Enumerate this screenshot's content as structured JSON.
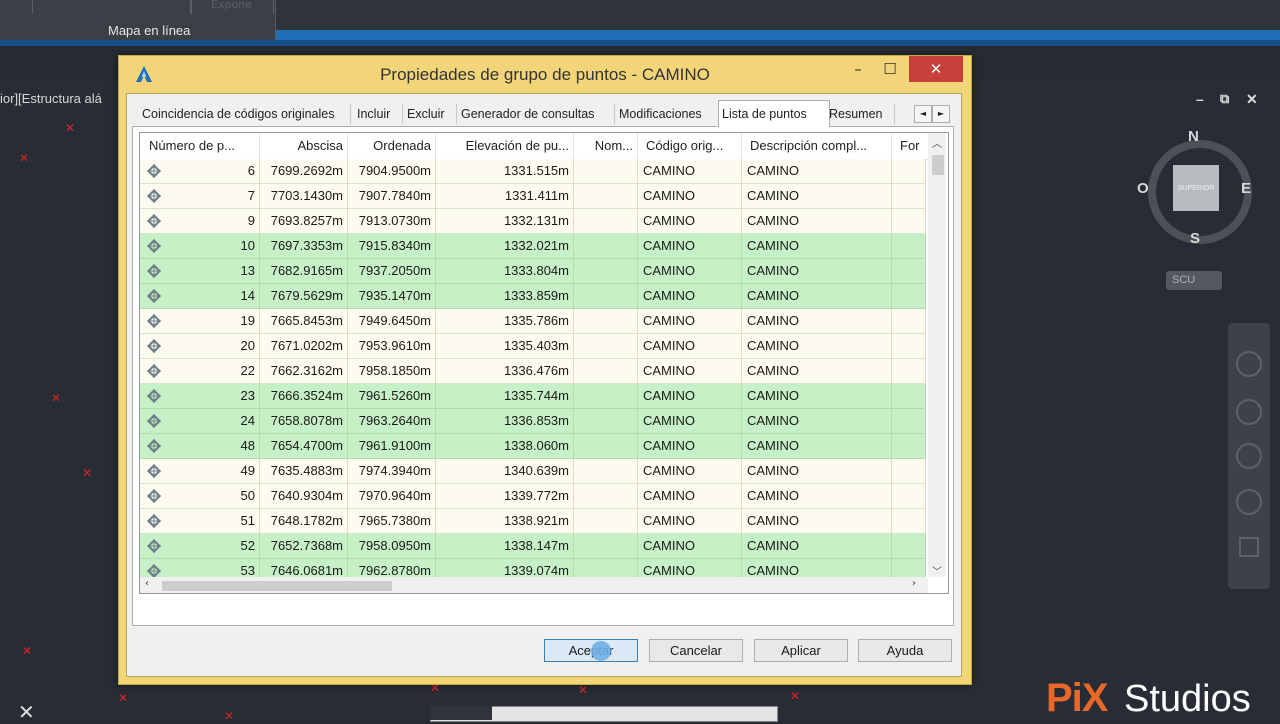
{
  "ribbon": {
    "label": "Mapa en línea",
    "faint_label": "Expone"
  },
  "drawing": {
    "header": "ior][Estructura alá"
  },
  "window_controls": {
    "minimize": "–",
    "restore": "⧉",
    "close": "✕"
  },
  "viewcube": {
    "face": "SUPERIOR",
    "north": "N",
    "south": "S",
    "east": "E",
    "west": "O",
    "ucs": "SCU"
  },
  "dialog": {
    "title": "Propiedades de grupo de puntos - CAMINO",
    "minimize": "–",
    "maximize": "☐",
    "close": "✕",
    "tabs": [
      "Coincidencia de códigos originales",
      "Incluir",
      "Excluir",
      "Generador de consultas",
      "Modificaciones",
      "Lista de puntos",
      "Resumen"
    ],
    "active_tab": "Lista de puntos",
    "tab_prev": "◄",
    "tab_next": "►",
    "columns": [
      "Número de p...",
      "Abscisa",
      "Ordenada",
      "Elevación de pu...",
      "Nom...",
      "Código orig...",
      "Descripción compl...",
      "For"
    ],
    "rows": [
      {
        "num": "6",
        "abscisa": "7699.2692m",
        "ordenada": "7904.9500m",
        "elevacion": "1331.515m",
        "nombre": "",
        "codigo": "CAMINO",
        "descripcion": "CAMINO",
        "highlight": false
      },
      {
        "num": "7",
        "abscisa": "7703.1430m",
        "ordenada": "7907.7840m",
        "elevacion": "1331.411m",
        "nombre": "",
        "codigo": "CAMINO",
        "descripcion": "CAMINO",
        "highlight": false
      },
      {
        "num": "9",
        "abscisa": "7693.8257m",
        "ordenada": "7913.0730m",
        "elevacion": "1332.131m",
        "nombre": "",
        "codigo": "CAMINO",
        "descripcion": "CAMINO",
        "highlight": false
      },
      {
        "num": "10",
        "abscisa": "7697.3353m",
        "ordenada": "7915.8340m",
        "elevacion": "1332.021m",
        "nombre": "",
        "codigo": "CAMINO",
        "descripcion": "CAMINO",
        "highlight": true
      },
      {
        "num": "13",
        "abscisa": "7682.9165m",
        "ordenada": "7937.2050m",
        "elevacion": "1333.804m",
        "nombre": "",
        "codigo": "CAMINO",
        "descripcion": "CAMINO",
        "highlight": true
      },
      {
        "num": "14",
        "abscisa": "7679.5629m",
        "ordenada": "7935.1470m",
        "elevacion": "1333.859m",
        "nombre": "",
        "codigo": "CAMINO",
        "descripcion": "CAMINO",
        "highlight": true
      },
      {
        "num": "19",
        "abscisa": "7665.8453m",
        "ordenada": "7949.6450m",
        "elevacion": "1335.786m",
        "nombre": "",
        "codigo": "CAMINO",
        "descripcion": "CAMINO",
        "highlight": false
      },
      {
        "num": "20",
        "abscisa": "7671.0202m",
        "ordenada": "7953.9610m",
        "elevacion": "1335.403m",
        "nombre": "",
        "codigo": "CAMINO",
        "descripcion": "CAMINO",
        "highlight": false
      },
      {
        "num": "22",
        "abscisa": "7662.3162m",
        "ordenada": "7958.1850m",
        "elevacion": "1336.476m",
        "nombre": "",
        "codigo": "CAMINO",
        "descripcion": "CAMINO",
        "highlight": false
      },
      {
        "num": "23",
        "abscisa": "7666.3524m",
        "ordenada": "7961.5260m",
        "elevacion": "1335.744m",
        "nombre": "",
        "codigo": "CAMINO",
        "descripcion": "CAMINO",
        "highlight": true
      },
      {
        "num": "24",
        "abscisa": "7658.8078m",
        "ordenada": "7963.2640m",
        "elevacion": "1336.853m",
        "nombre": "",
        "codigo": "CAMINO",
        "descripcion": "CAMINO",
        "highlight": true
      },
      {
        "num": "48",
        "abscisa": "7654.4700m",
        "ordenada": "7961.9100m",
        "elevacion": "1338.060m",
        "nombre": "",
        "codigo": "CAMINO",
        "descripcion": "CAMINO",
        "highlight": true
      },
      {
        "num": "49",
        "abscisa": "7635.4883m",
        "ordenada": "7974.3940m",
        "elevacion": "1340.639m",
        "nombre": "",
        "codigo": "CAMINO",
        "descripcion": "CAMINO",
        "highlight": false
      },
      {
        "num": "50",
        "abscisa": "7640.9304m",
        "ordenada": "7970.9640m",
        "elevacion": "1339.772m",
        "nombre": "",
        "codigo": "CAMINO",
        "descripcion": "CAMINO",
        "highlight": false
      },
      {
        "num": "51",
        "abscisa": "7648.1782m",
        "ordenada": "7965.7380m",
        "elevacion": "1338.921m",
        "nombre": "",
        "codigo": "CAMINO",
        "descripcion": "CAMINO",
        "highlight": false
      },
      {
        "num": "52",
        "abscisa": "7652.7368m",
        "ordenada": "7958.0950m",
        "elevacion": "1338.147m",
        "nombre": "",
        "codigo": "CAMINO",
        "descripcion": "CAMINO",
        "highlight": true
      },
      {
        "num": "53",
        "abscisa": "7646.0681m",
        "ordenada": "7962.8780m",
        "elevacion": "1339.074m",
        "nombre": "",
        "codigo": "CAMINO",
        "descripcion": "CAMINO",
        "highlight": true
      }
    ],
    "buttons": {
      "ok": "Aceptar",
      "cancel": "Cancelar",
      "apply": "Aplicar",
      "help": "Ayuda"
    }
  },
  "logo": {
    "part1": "PiX",
    "part2": "Studios"
  },
  "colors": {
    "dialog_frame": "#f3d579",
    "row_highlight": "#c6f0c6",
    "row_plain": "#fdfbef",
    "close_button": "#c7403a",
    "cad_background": "#272c35",
    "point_marker": "#d9252b"
  }
}
